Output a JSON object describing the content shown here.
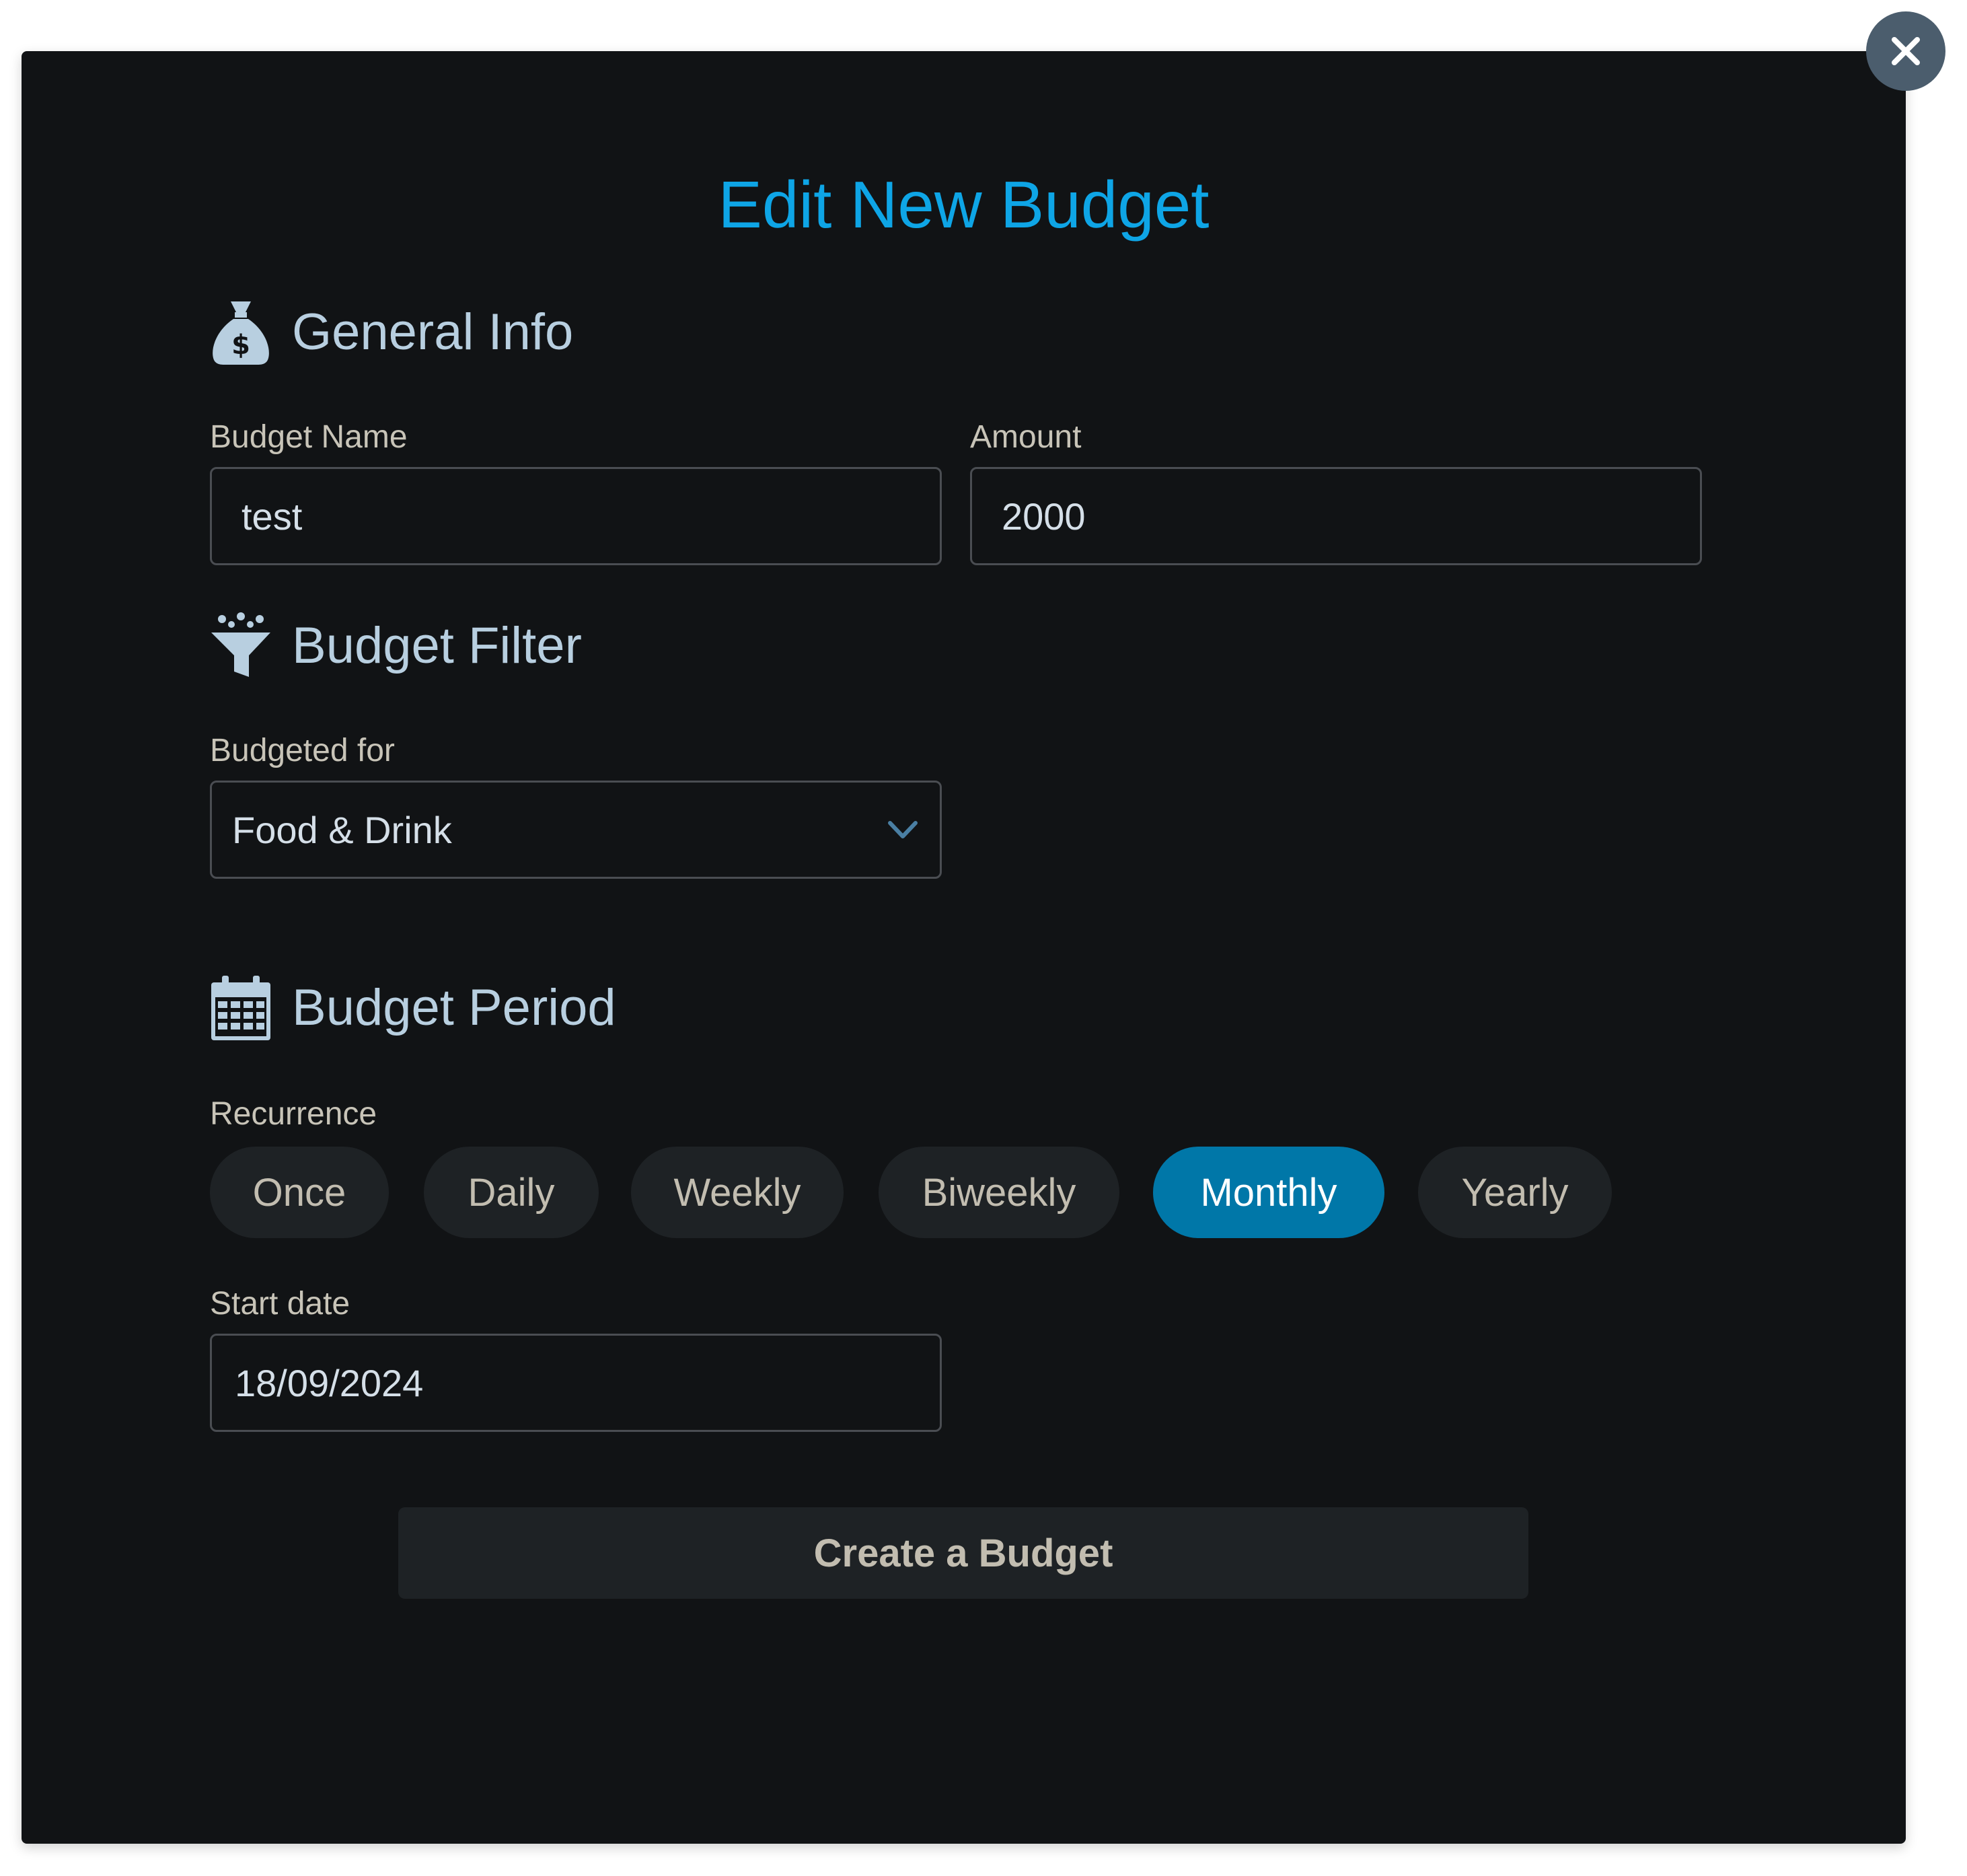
{
  "modal": {
    "title": "Edit New Budget",
    "close_icon": "close-icon"
  },
  "general_info": {
    "heading": "General Info",
    "icon": "money-bag-icon",
    "budget_name_label": "Budget Name",
    "budget_name_value": "test",
    "amount_label": "Amount",
    "amount_value": "2000"
  },
  "budget_filter": {
    "heading": "Budget Filter",
    "icon": "funnel-icon",
    "budgeted_for_label": "Budgeted for",
    "budgeted_for_value": "Food & Drink"
  },
  "budget_period": {
    "heading": "Budget Period",
    "icon": "calendar-icon",
    "recurrence_label": "Recurrence",
    "recurrence_options": [
      "Once",
      "Daily",
      "Weekly",
      "Biweekly",
      "Monthly",
      "Yearly"
    ],
    "recurrence_selected": "Monthly",
    "start_date_label": "Start date",
    "start_date_value": "18/09/2024"
  },
  "actions": {
    "create_label": "Create a Budget"
  },
  "colors": {
    "accent": "#0ea5e6",
    "selected_pill": "#0077a8",
    "modal_bg": "#111315",
    "heading_text": "#b8cfe0"
  }
}
